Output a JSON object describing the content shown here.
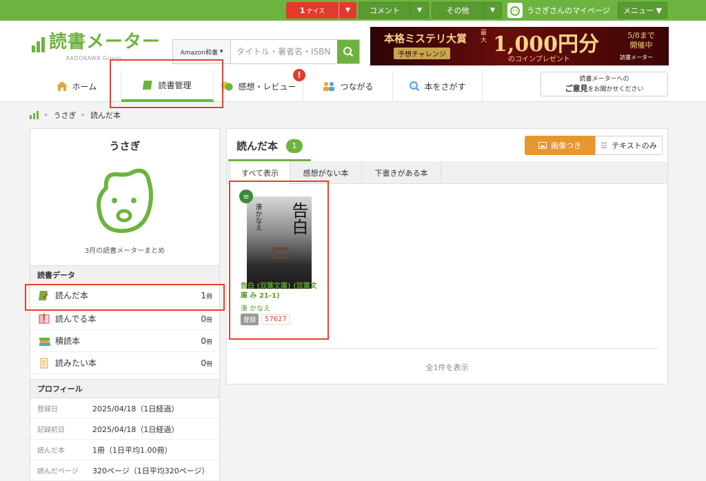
{
  "topbar": {
    "nice_count": "1",
    "nice_unit": "ナイス",
    "comment_label": "コメント",
    "other_label": "その他",
    "mypage_label": "うさぎさんのマイページ",
    "menu_label": "メニュー ▼"
  },
  "header": {
    "logo_text": "読書メーター",
    "logo_sub": "KADOKAWA Group",
    "search": {
      "selector": "Amazon和書",
      "placeholder": "タイトル・著者名・ISBN"
    },
    "banner": {
      "title": "本格ミステリ大賞",
      "subtitle": "予想チャレンジ",
      "max_prefix": "最大",
      "amount": "1,000円分",
      "present": "のコインプレゼント",
      "date": "5/8まで 開催中",
      "brand": "読書メーター"
    },
    "nav": [
      {
        "label": "ホーム"
      },
      {
        "label": "読書管理"
      },
      {
        "label": "感想・レビュー",
        "badge": "!"
      },
      {
        "label": "つながる"
      },
      {
        "label": "本をさがす"
      }
    ],
    "feedback": {
      "line1": "読書メーターへの",
      "bold": "ご意見",
      "line2": "をお聞かせください"
    }
  },
  "breadcrumb": [
    "うさぎ",
    "読んだ本"
  ],
  "profile_card": {
    "user_name": "うさぎ",
    "summary_link": "3月の読書メーターまとめ",
    "data_heading": "読書データ",
    "data": [
      {
        "label": "読んだ本",
        "count": "1",
        "unit": "冊"
      },
      {
        "label": "読んでる本",
        "count": "0",
        "unit": "冊"
      },
      {
        "label": "積読本",
        "count": "0",
        "unit": "冊"
      },
      {
        "label": "読みたい本",
        "count": "0",
        "unit": "冊"
      }
    ],
    "profile_heading": "プロフィール",
    "profile": [
      {
        "key": "登録日",
        "value": "2025/04/18（1日経過）"
      },
      {
        "key": "記録初日",
        "value": "2025/04/18（1日経過）"
      },
      {
        "key": "読んだ本",
        "value": "1冊（1日平均1.00冊）"
      },
      {
        "key": "読んだページ",
        "value": "320ページ（1日平均320ページ）"
      }
    ]
  },
  "main": {
    "title": "読んだ本",
    "count": "1",
    "view_image": "画像つき",
    "view_text": "テキストのみ",
    "tabs": [
      "すべて表示",
      "感想がない本",
      "下書きがある本"
    ],
    "book": {
      "cover_title": "告白",
      "cover_author": "湊かなえ",
      "title": "告白 (双葉文庫) (双葉文庫 み 21-1)",
      "author": "湊 かなえ",
      "reg_tag": "登録",
      "reg_count": "57627"
    },
    "total": "全1件を表示"
  },
  "colors": {
    "brand": "#6db33f",
    "nice": "#e23b2e",
    "view_active": "#e8962e",
    "highlight": "#e2422e"
  }
}
